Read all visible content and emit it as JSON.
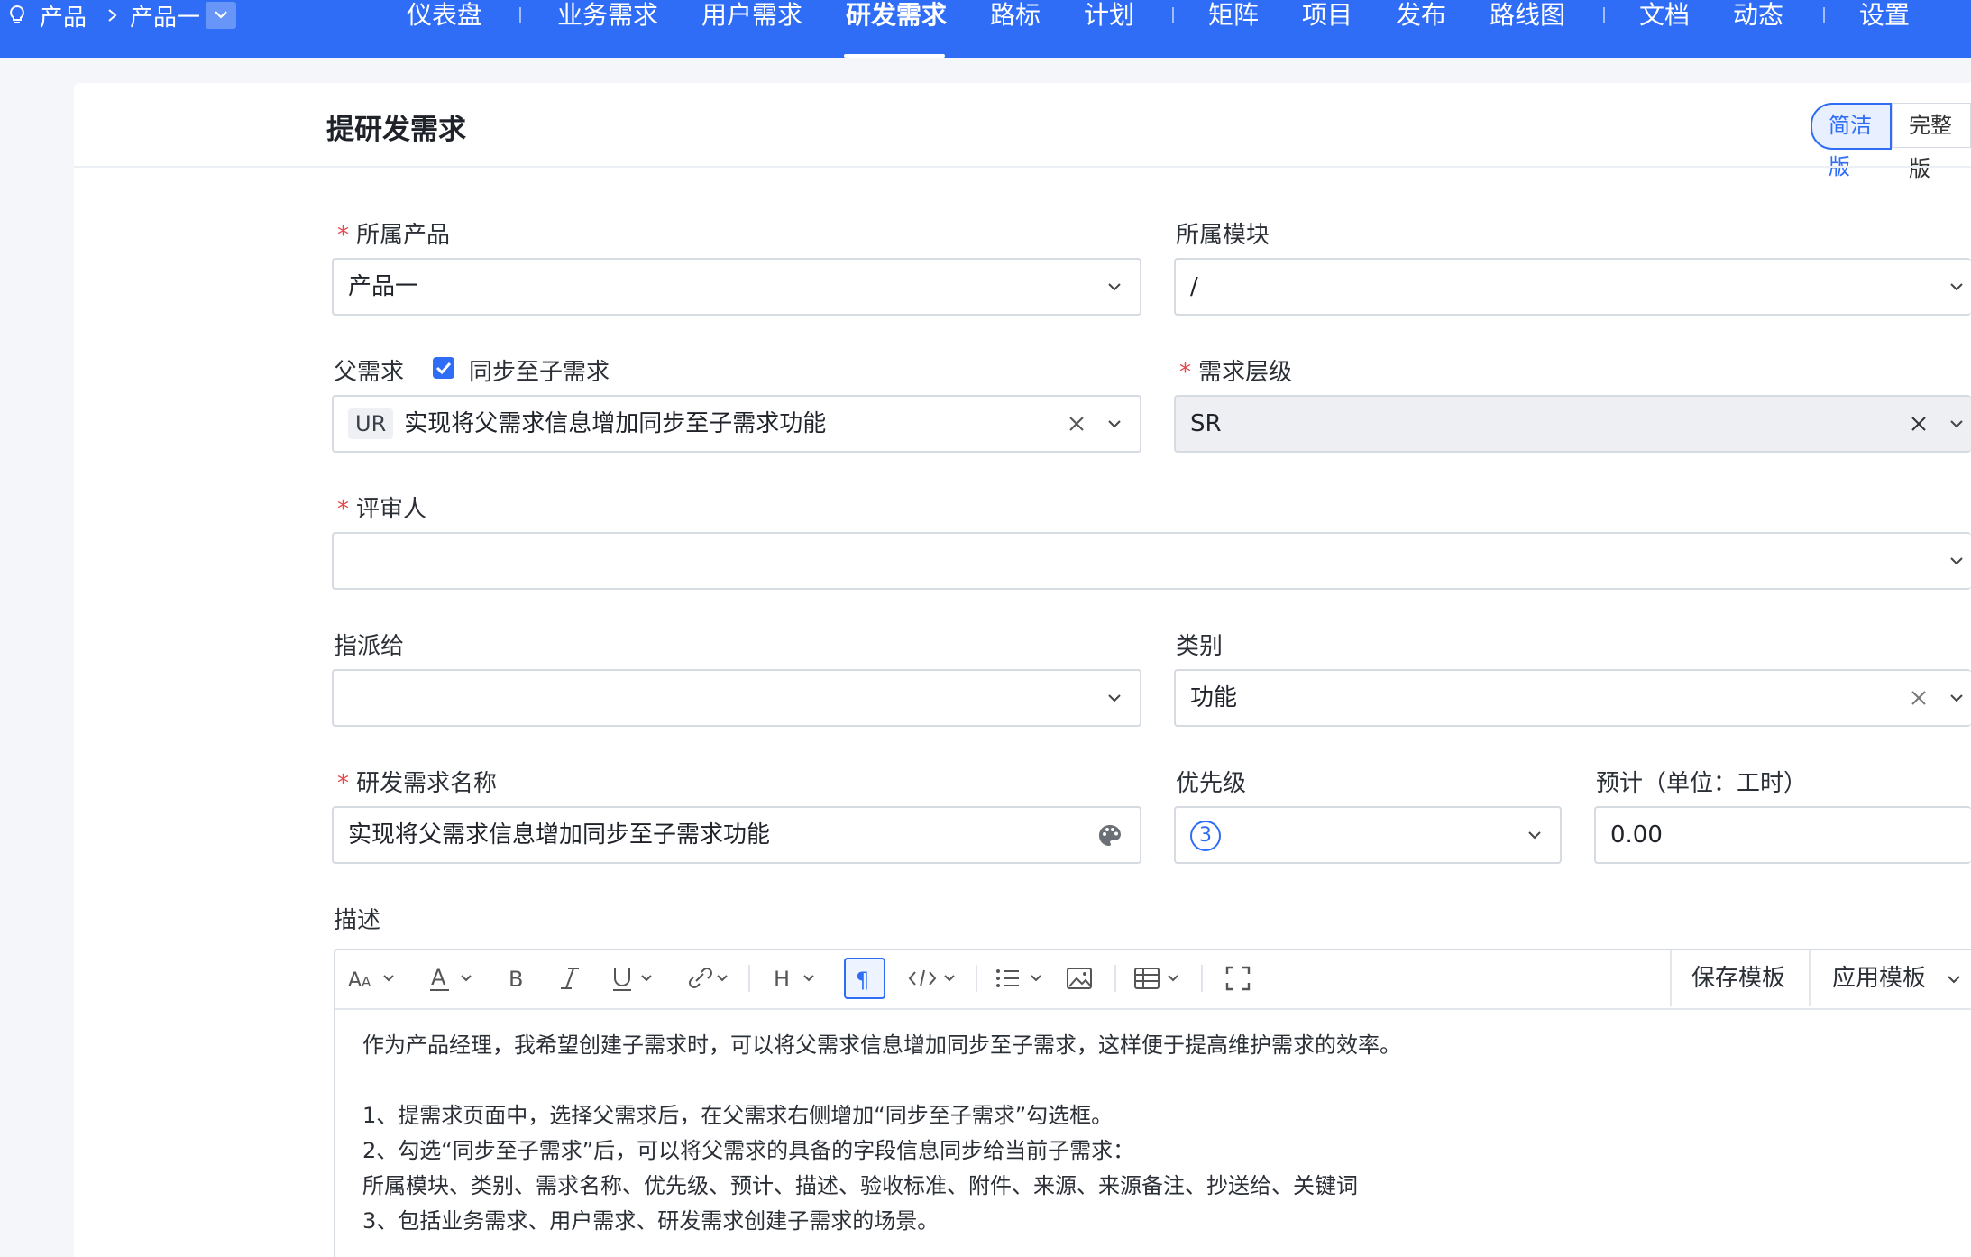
{
  "breadcrumb": {
    "product": "产品",
    "current": "产品一"
  },
  "nav": {
    "items": [
      "仪表盘",
      "业务需求",
      "用户需求",
      "研发需求",
      "路标",
      "计划",
      "矩阵",
      "项目",
      "发布",
      "路线图",
      "文档",
      "动态",
      "设置"
    ],
    "active": "研发需求"
  },
  "page": {
    "title": "提研发需求",
    "mode_simple": "简洁版",
    "mode_full": "完整版"
  },
  "form": {
    "product_label": "所属产品",
    "product_value": "产品一",
    "module_label": "所属模块",
    "module_value": "/",
    "parent_label": "父需求",
    "sync_label": "同步至子需求",
    "sync_checked": true,
    "parent_tag": "UR",
    "parent_value": "实现将父需求信息增加同步至子需求功能",
    "level_label": "需求层级",
    "level_value": "SR",
    "reviewer_label": "评审人",
    "reviewer_value": "",
    "assignee_label": "指派给",
    "assignee_value": "",
    "category_label": "类别",
    "category_value": "功能",
    "name_label": "研发需求名称",
    "name_value": "实现将父需求信息增加同步至子需求功能",
    "priority_label": "优先级",
    "priority_value": "3",
    "estimate_label": "预计（单位：工时）",
    "estimate_value": "0.00",
    "desc_label": "描述"
  },
  "editor": {
    "save_template": "保存模板",
    "apply_template": "应用模板",
    "lines": [
      "作为产品经理，我希望创建子需求时，可以将父需求信息增加同步至子需求，这样便于提高维护需求的效率。",
      "",
      "1、提需求页面中，选择父需求后，在父需求右侧增加“同步至子需求”勾选框。",
      "2、勾选“同步至子需求”后，可以将父需求的具备的字段信息同步给当前子需求：",
      "所属模块、类别、需求名称、优先级、预计、描述、验收标准、附件、来源、来源备注、抄送给、关键词",
      "3、包括业务需求、用户需求、研发需求创建子需求的场景。"
    ]
  },
  "colors": {
    "primary": "#2f6df6",
    "required": "#e5484d"
  }
}
